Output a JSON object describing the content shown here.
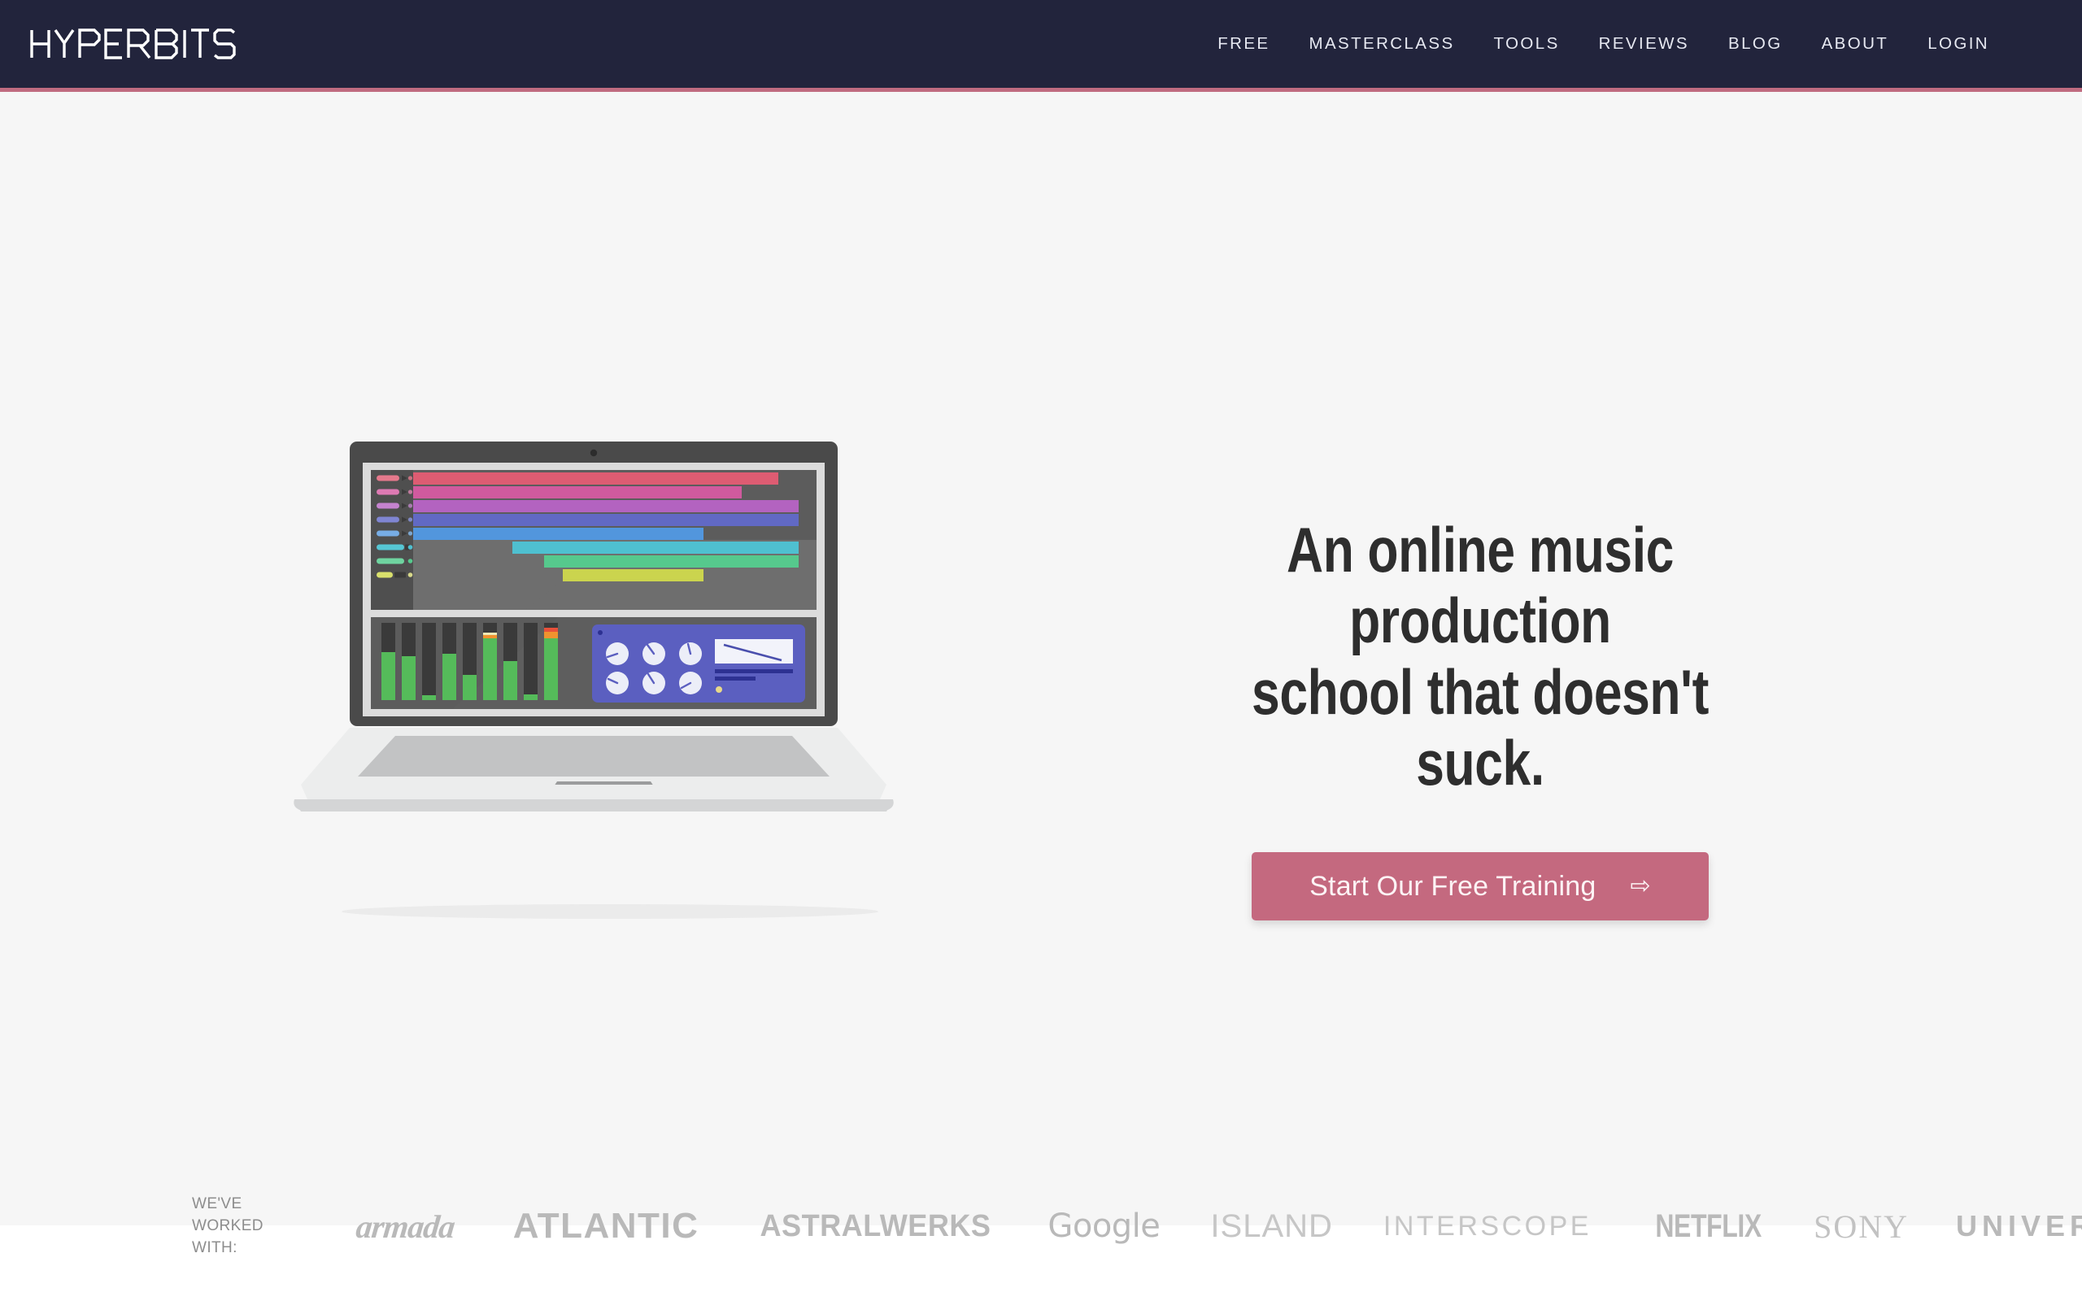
{
  "header": {
    "logo_text": "HYPERBITS",
    "logo_icon": "hyperbits-wordmark",
    "bg_color": "#22243c",
    "accent_border_color": "#c06b80",
    "nav": [
      {
        "label": "FREE"
      },
      {
        "label": "MASTERCLASS"
      },
      {
        "label": "TOOLS"
      },
      {
        "label": "REVIEWS"
      },
      {
        "label": "BLOG"
      },
      {
        "label": "ABOUT"
      },
      {
        "label": "LOGIN"
      }
    ]
  },
  "hero": {
    "bg_color": "#f6f6f6",
    "headline": "An online music production\nschool that doesn't suck.",
    "cta": {
      "label": "Start Our Free Training",
      "arrow_icon": "⇨",
      "bg_color": "#c4697f",
      "text_color": "#fdf3f5"
    },
    "illustration": {
      "icon": "laptop-daw-illustration",
      "body_color": "#eceded",
      "bezel_color": "#4a4a4a",
      "screen_bg": "#5c5c5c",
      "keyboard_color": "#c2c3c4",
      "trackpad_color": "#9b9c9d",
      "arrangement": {
        "sidebar_color": "#4f4f4f",
        "tracks": [
          {
            "name": "track-1",
            "color": "#dd5c72",
            "clip_start": 0,
            "clip_width": 0.905
          },
          {
            "name": "track-2",
            "color": "#d05a9e",
            "clip_start": 0,
            "clip_width": 0.815
          },
          {
            "name": "track-3",
            "color": "#b363c0",
            "clip_start": 0,
            "clip_width": 0.955
          },
          {
            "name": "track-4",
            "color": "#6169c4",
            "clip_start": 0,
            "clip_width": 0.955
          },
          {
            "name": "track-5",
            "color": "#5296dd",
            "clip_start": 0,
            "clip_width": 0.72
          },
          {
            "name": "track-6",
            "color": "#4fc0d0",
            "clip_start": 0.245,
            "clip_width": 0.71
          },
          {
            "name": "track-7",
            "color": "#56c98d",
            "clip_start": 0.35,
            "clip_width": 0.605
          },
          {
            "name": "track-8",
            "color": "#cbd44e",
            "clip_start": 0.4,
            "clip_width": 0.335
          }
        ]
      },
      "mixer": {
        "channel_count": 9,
        "level_color": "#55bb5a",
        "peak_color": "#f0932f",
        "levels": [
          0.62,
          0.57,
          0.06,
          0.6,
          0.33,
          0.86,
          0.52,
          0.07,
          0.9
        ],
        "peaks": [
          false,
          false,
          false,
          false,
          false,
          true,
          false,
          false,
          true
        ]
      },
      "plugin": {
        "panel_color": "#5b5fc0",
        "knob_color": "#eceef8",
        "knob_count": 6,
        "display_color": "#f2f3fa",
        "bar_color": "#2d3192",
        "led_color": "#e8d98a"
      }
    },
    "logo_strip": {
      "label": "WE'VE\nWORKED\nWITH:",
      "brands": [
        {
          "name": "armada",
          "label": "armada"
        },
        {
          "name": "atlantic",
          "label": "ATLANTIC"
        },
        {
          "name": "astralwerks",
          "label": "ASTRALWERKS"
        },
        {
          "name": "google",
          "label": "Google"
        },
        {
          "name": "island",
          "label": "ISLAND"
        },
        {
          "name": "interscope",
          "label": "INTERSCOPE"
        },
        {
          "name": "netflix",
          "label": "NETFLIX"
        },
        {
          "name": "sony",
          "label": "SONY"
        },
        {
          "name": "universal",
          "label": "UNIVERSAL"
        }
      ]
    }
  }
}
